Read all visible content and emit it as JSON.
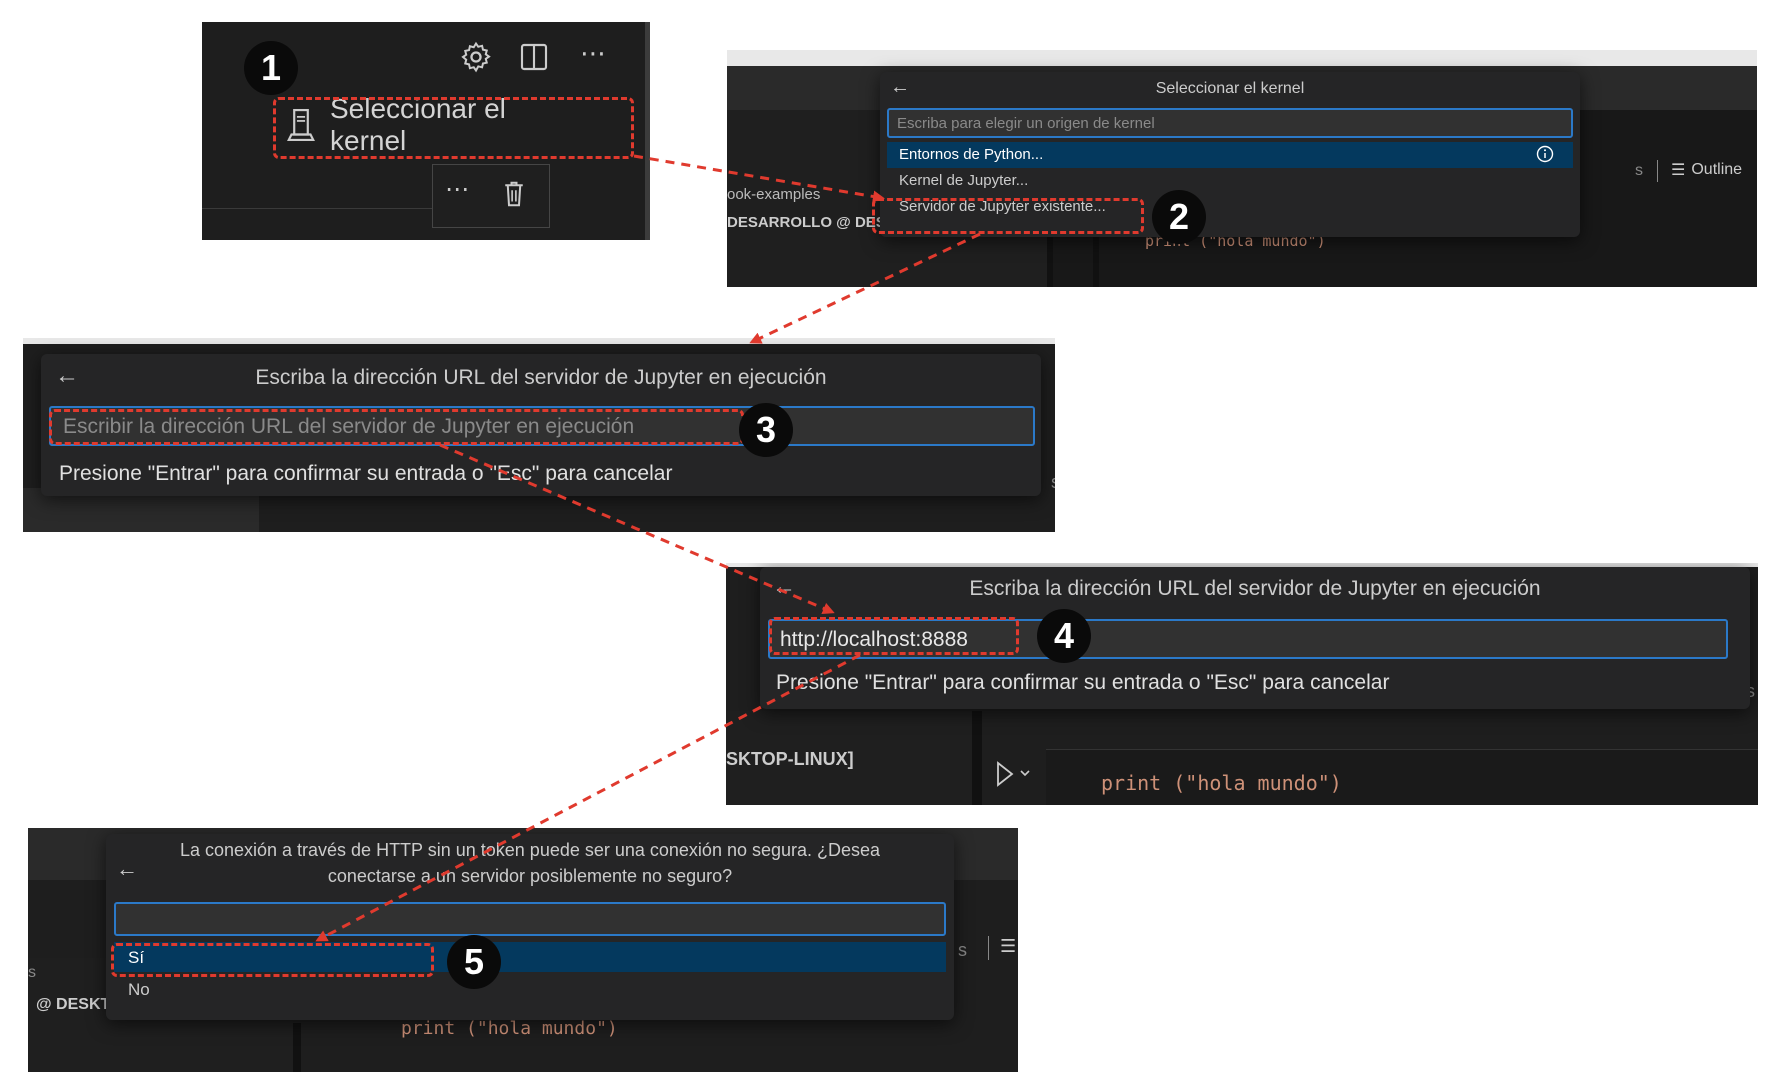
{
  "step1": {
    "badge": "1",
    "select_kernel_label": "Seleccionar el kernel",
    "icons": [
      "gear-icon",
      "split-editor-icon",
      "more-actions-icon",
      "kernel-icon",
      "trash-icon"
    ]
  },
  "step2": {
    "badge": "2",
    "quickpick_title": "Seleccionar el kernel",
    "input_placeholder": "Escriba para elegir un origen de kernel",
    "options": [
      "Entornos de Python...",
      "Kernel de Jupyter...",
      "Servidor de Jupyter existente..."
    ],
    "bg_left_1": "ook-examples",
    "bg_left_2": "DESARROLLO @ DESKT",
    "bg_right_s": "s",
    "bg_outline": "Outline",
    "bg_code": "print (\"hola mundo\")"
  },
  "step3": {
    "badge": "3",
    "quickpick_title": "Escriba la dirección URL del servidor de Jupyter en ejecución",
    "input_placeholder": "Escribir la dirección URL del servidor de Jupyter en ejecución",
    "hint": "Presione \"Entrar\" para confirmar su entrada o \"Esc\" para cancelar",
    "bg_right_s": "s"
  },
  "step4": {
    "badge": "4",
    "quickpick_title": "Escriba la dirección URL del servidor de Jupyter en ejecución",
    "input_value": "http://localhost:8888",
    "hint": "Presione \"Entrar\" para confirmar su entrada o \"Esc\" para cancelar",
    "bg_right_s": "s",
    "bg_left": "SKTOP-LINUX]",
    "bg_code": "print (\"hola mundo\")"
  },
  "step5": {
    "badge": "5",
    "quickpick_title_line1": "La conexión a través de HTTP sin un token puede ser una conexión no segura. ¿Desea",
    "quickpick_title_line2": "conectarse a un servidor posiblemente no seguro?",
    "options": [
      "Sí",
      "No"
    ],
    "bg_left_s": "s",
    "bg_left": "@ DESKT",
    "bg_right_s": "s",
    "bg_code": "print (\"hola mundo\")"
  },
  "colors": {
    "panel_bg": "#1f1f1f",
    "quickpick_bg": "#252526",
    "selection_bg": "#04395e",
    "input_border": "#2b79c8",
    "annotation_red": "#e03a2e",
    "code_string": "#ce9178",
    "code_keyword": "#dcdcaa"
  }
}
